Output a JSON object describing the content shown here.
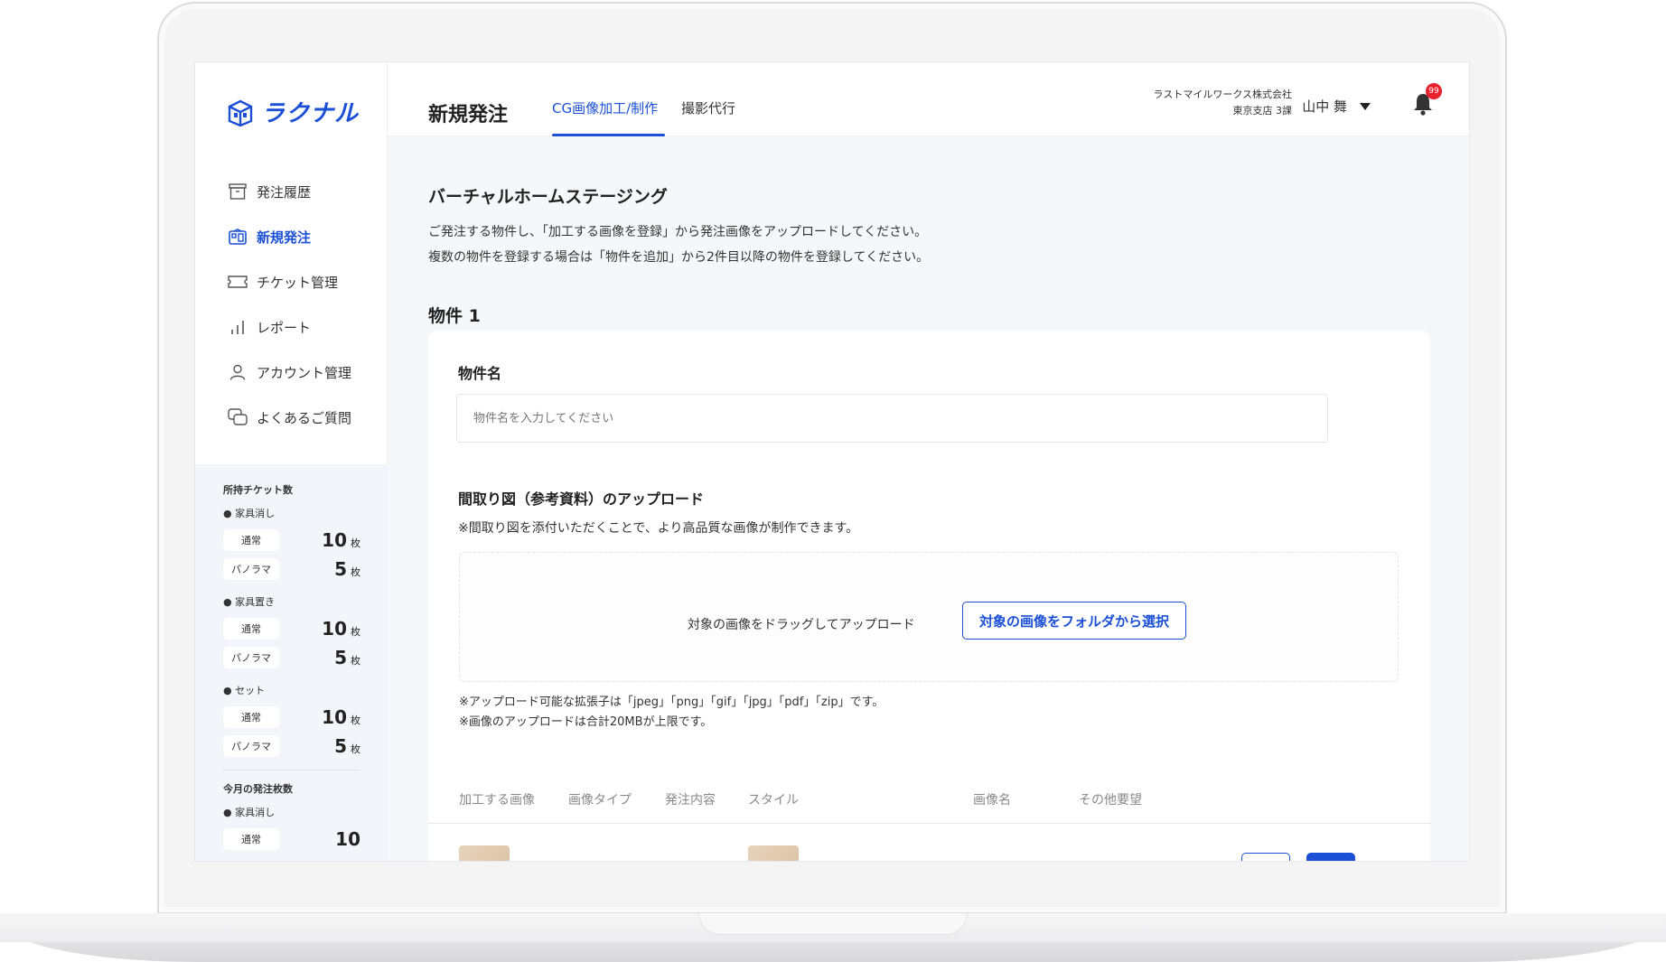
{
  "brand": {
    "logo_text": "ラクナル",
    "accent_color": "#1a4fd6"
  },
  "sidebar": {
    "items": [
      {
        "label": "発注履歴",
        "icon": "archive-box-icon",
        "active": false
      },
      {
        "label": "新規発注",
        "icon": "building-icon",
        "active": true
      },
      {
        "label": "チケット管理",
        "icon": "ticket-icon",
        "active": false
      },
      {
        "label": "レポート",
        "icon": "bar-chart-icon",
        "active": false
      },
      {
        "label": "アカウント管理",
        "icon": "user-icon",
        "active": false
      },
      {
        "label": "よくあるご質問",
        "icon": "chat-bubbles-icon",
        "active": false
      }
    ],
    "tickets": {
      "heading": "所持チケット数",
      "groups": [
        {
          "name": "● 家具消し",
          "rows": [
            {
              "type": "通常",
              "count": "10",
              "unit": "枚"
            },
            {
              "type": "パノラマ",
              "count": "5",
              "unit": "枚"
            }
          ]
        },
        {
          "name": "● 家具置き",
          "rows": [
            {
              "type": "通常",
              "count": "10",
              "unit": "枚"
            },
            {
              "type": "パノラマ",
              "count": "5",
              "unit": "枚"
            }
          ]
        },
        {
          "name": "● セット",
          "rows": [
            {
              "type": "通常",
              "count": "10",
              "unit": "枚"
            },
            {
              "type": "パノラマ",
              "count": "5",
              "unit": "枚"
            }
          ]
        }
      ],
      "monthly_heading": "今月の発注枚数",
      "monthly_group": "● 家具消し",
      "monthly_row": {
        "type": "通常",
        "count": "10"
      }
    }
  },
  "header": {
    "title": "新規発注",
    "tabs": [
      {
        "label": "CG画像加工/制作",
        "active": true
      },
      {
        "label": "撮影代行",
        "active": false
      }
    ],
    "company": "ラストマイルワークス株式会社",
    "branch": "東京支店 3課",
    "user_name": "山中 舞",
    "notification_count": "99"
  },
  "main": {
    "section_title": "バーチャルホームステージング",
    "desc_line1": "ご発注する物件し、「加工する画像を登録」から発注画像をアップロードしてください。",
    "desc_line2": "複数の物件を登録する場合は「物件を追加」から2件目以降の物件を登録してください。",
    "property_title": "物件 1",
    "property_name_label": "物件名",
    "property_name_placeholder": "物件名を入力してください",
    "floorplan_label": "間取り図（参考資料）のアップロード",
    "floorplan_note": "※間取り図を添付いただくことで、より高品質な画像が制作できます。",
    "drop_text": "対象の画像をドラッグしてアップロード",
    "select_button": "対象の画像をフォルダから選択",
    "ext_note1": "※アップロード可能な拡張子は「jpeg」「png」「gif」「jpg」「pdf」「zip」です。",
    "ext_note2": "※画像のアップロードは合計20MBが上限です。",
    "table_headers": [
      "加工する画像",
      "画像タイプ",
      "発注内容",
      "スタイル",
      "画像名",
      "その他要望"
    ]
  }
}
